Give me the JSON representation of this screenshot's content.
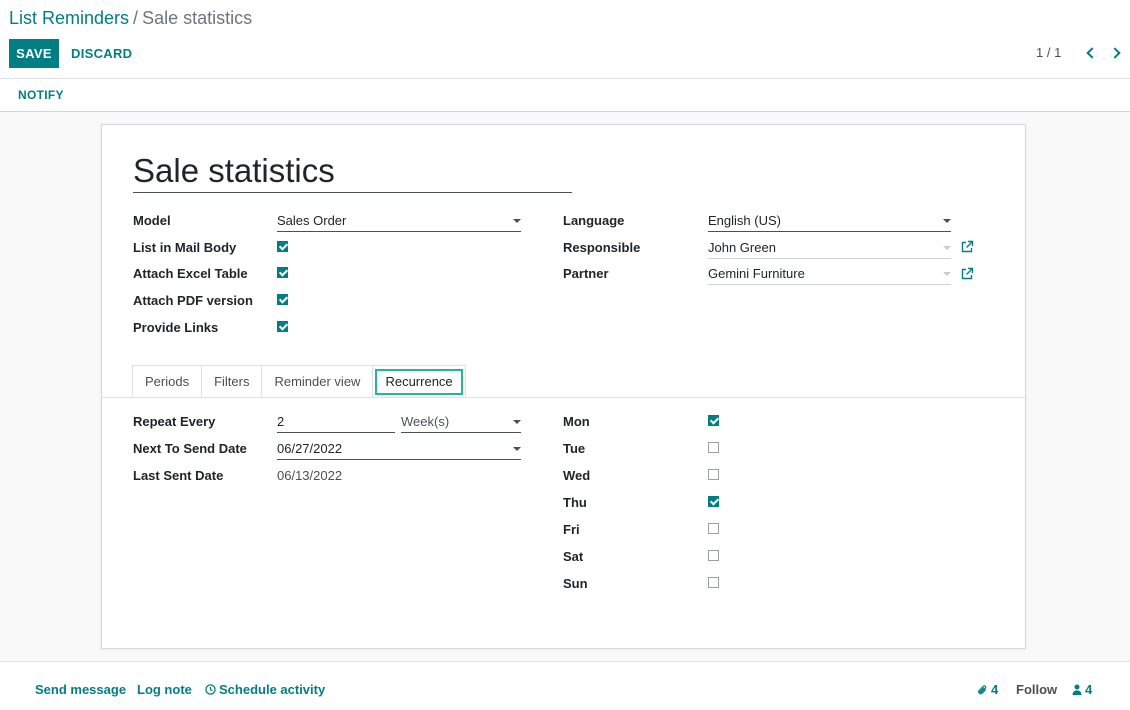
{
  "breadcrumb": {
    "parent": "List Reminders",
    "separator": "/",
    "current": "Sale statistics"
  },
  "toolbar": {
    "save_label": "SAVE",
    "discard_label": "DISCARD"
  },
  "pager": {
    "value": "1 / 1"
  },
  "statusbar": {
    "notify_label": "NOTIFY"
  },
  "record": {
    "title": "Sale statistics",
    "model_label": "Model",
    "model_value": "Sales Order",
    "list_in_mail_body_label": "List in Mail Body",
    "list_in_mail_body": true,
    "attach_excel_label": "Attach Excel Table",
    "attach_excel": true,
    "attach_pdf_label": "Attach PDF version",
    "attach_pdf": true,
    "provide_links_label": "Provide Links",
    "provide_links": true,
    "language_label": "Language",
    "language_value": "English (US)",
    "responsible_label": "Responsible",
    "responsible_value": "John Green",
    "partner_label": "Partner",
    "partner_value": "Gemini Furniture"
  },
  "tabs": [
    {
      "label": "Periods",
      "active": false
    },
    {
      "label": "Filters",
      "active": false
    },
    {
      "label": "Reminder view",
      "active": false
    },
    {
      "label": "Recurrence",
      "active": true
    }
  ],
  "recurrence": {
    "repeat_every_label": "Repeat Every",
    "repeat_every_value": "2",
    "repeat_unit": "Week(s)",
    "next_send_label": "Next To Send Date",
    "next_send_value": "06/27/2022",
    "last_sent_label": "Last Sent Date",
    "last_sent_value": "06/13/2022",
    "days": [
      {
        "label": "Mon",
        "checked": true
      },
      {
        "label": "Tue",
        "checked": false
      },
      {
        "label": "Wed",
        "checked": false
      },
      {
        "label": "Thu",
        "checked": true
      },
      {
        "label": "Fri",
        "checked": false
      },
      {
        "label": "Sat",
        "checked": false
      },
      {
        "label": "Sun",
        "checked": false
      }
    ]
  },
  "chatter": {
    "send_message": "Send message",
    "log_note": "Log note",
    "schedule_activity": "Schedule activity",
    "attachments_count": "4",
    "follow": "Follow",
    "followers_count": "4"
  },
  "colors": {
    "primary": "#017e84",
    "tab_focus": "#21b799"
  },
  "icons": {
    "external": "external-link-icon",
    "clock": "clock-icon",
    "paperclip": "paperclip-icon",
    "user": "user-icon"
  }
}
